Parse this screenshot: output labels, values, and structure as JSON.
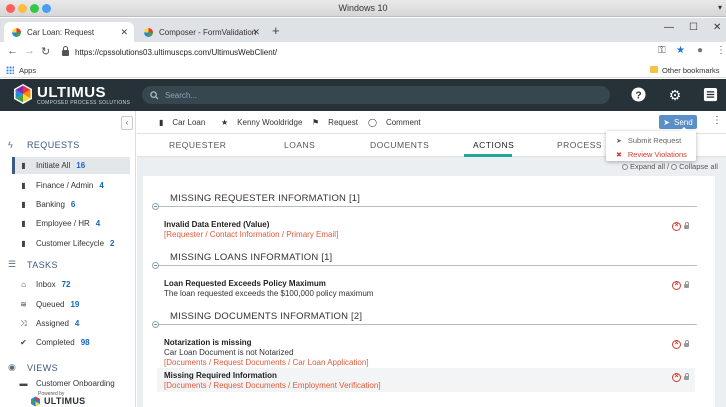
{
  "os": {
    "title": "Windows 10",
    "menu_icon": "chevron-down-icon"
  },
  "browser": {
    "tabs": [
      {
        "label": "Car Loan: Request",
        "close": "✕"
      },
      {
        "label": "Composer - FormValidation",
        "close": "✕"
      }
    ],
    "new_tab": "+",
    "window_controls": [
      "—",
      "☐",
      "✕"
    ],
    "url": "https://cpssolutions03.ultimuscps.com/UltimusWebClient/",
    "bookmarks": {
      "apps": "Apps",
      "other": "Other bookmarks"
    }
  },
  "header": {
    "logo": "ULTIMUS",
    "logo_sub": "COMPOSED PROCESS SOLUTIONS",
    "search_placeholder": "Search..."
  },
  "sidebar": {
    "requests": {
      "title": "REQUESTS",
      "items": [
        {
          "label": "Initiate All",
          "count": "16"
        },
        {
          "label": "Finance / Admin",
          "count": "4"
        },
        {
          "label": "Banking",
          "count": "6"
        },
        {
          "label": "Employee / HR",
          "count": "4"
        },
        {
          "label": "Customer Lifecycle",
          "count": "2"
        }
      ]
    },
    "tasks": {
      "title": "TASKS",
      "items": [
        {
          "label": "Inbox",
          "count": "72"
        },
        {
          "label": "Queued",
          "count": "19"
        },
        {
          "label": "Assigned",
          "count": "4"
        },
        {
          "label": "Completed",
          "count": "98"
        }
      ]
    },
    "views": {
      "title": "VIEWS",
      "partial_item": "Customer Onboarding"
    },
    "powered_by": "Powered by",
    "powered_logo": "ULTIMUS"
  },
  "context": {
    "process": "Car Loan",
    "user": "Kenny Wooldridge",
    "step": "Request",
    "comment": "Comment",
    "send": "Send"
  },
  "tabs": [
    "REQUESTER",
    "LOANS",
    "DOCUMENTS",
    "ACTIONS",
    "PROCESS"
  ],
  "send_menu": {
    "submit": "Submit Request",
    "review": "Review Violations"
  },
  "expand": {
    "expand_all": "Expand all",
    "collapse_all": "Collapse all",
    "separator": "/"
  },
  "groups": [
    {
      "title": "MISSING REQUESTER INFORMATION [1]",
      "items": [
        {
          "title": "Invalid Data Entered (Value)",
          "path": "[Requester / Contact Information / Primary Email]"
        }
      ]
    },
    {
      "title": "MISSING LOANS INFORMATION [1]",
      "items": [
        {
          "title": "Loan Requested Exceeds Policy Maximum",
          "desc": "The loan requested exceeds the $100,000 policy maximum"
        }
      ]
    },
    {
      "title": "MISSING DOCUMENTS INFORMATION [2]",
      "items": [
        {
          "title": "Notarization is missing",
          "desc": "Car Loan Document is not Notarized",
          "path": "[Documents / Request Documents / Car Loan Application]"
        },
        {
          "title": "Missing Required Information",
          "path": "[Documents / Request Documents / Employment Verification]"
        }
      ]
    }
  ],
  "colors": {
    "header_bg": "#263238",
    "accent_tab": "#26a69a",
    "send_btn": "#5b8fc7",
    "error": "#d63a2e",
    "path_text": "#e05a3a",
    "count": "#1565c0"
  }
}
